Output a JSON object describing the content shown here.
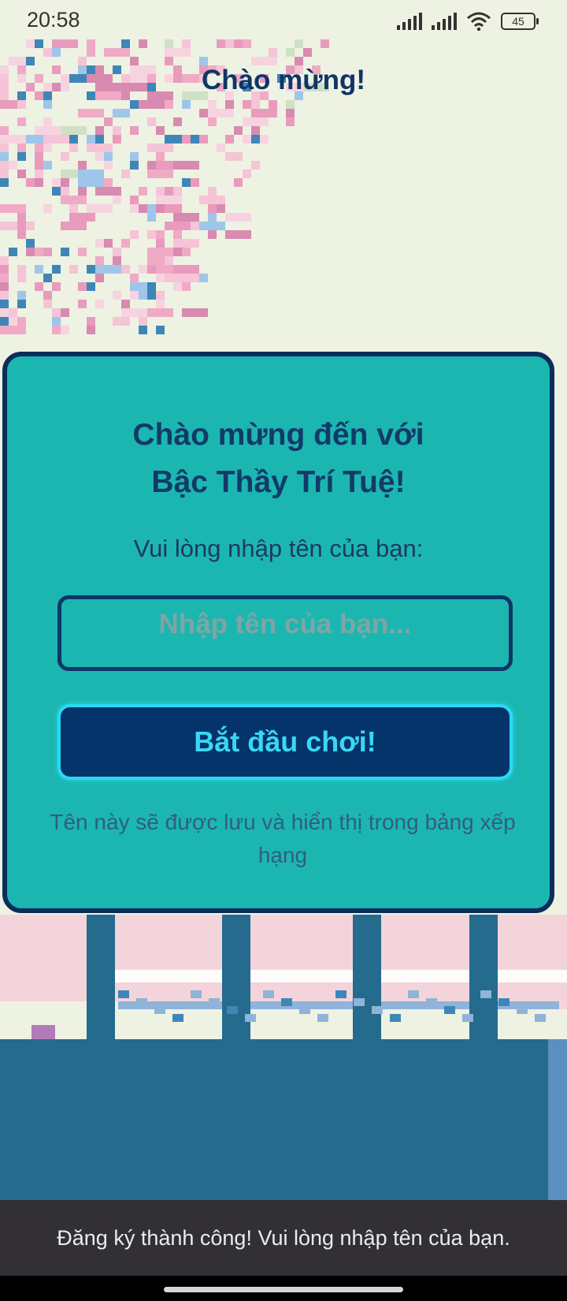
{
  "status_bar": {
    "time": "20:58",
    "battery": "45"
  },
  "header": {
    "title": "Chào mừng!"
  },
  "card": {
    "heading_line1": "Chào mừng đến với",
    "heading_line2": "Bậc Thầy Trí Tuệ!",
    "prompt": "Vui lòng nhập tên của bạn:",
    "input_placeholder": "Nhập tên của bạn...",
    "input_value": "",
    "start_button_label": "Bắt đầu chơi!",
    "note": "Tên này sẽ được lưu và hiển thị trong bảng xếp hạng"
  },
  "snackbar": {
    "message": "Đăng ký thành công! Vui lòng nhập tên của bạn."
  },
  "icons": {
    "signal_1": "cellular-signal-icon",
    "signal_2": "cellular-signal-icon",
    "wifi": "wifi-icon",
    "battery": "battery-icon"
  },
  "colors": {
    "card_background": "#1cb6b1",
    "card_border": "#0b2d5b",
    "button_background": "#04346a",
    "button_text": "#3ad7f5",
    "title_text": "#103566",
    "snackbar_background": "#322f35"
  }
}
